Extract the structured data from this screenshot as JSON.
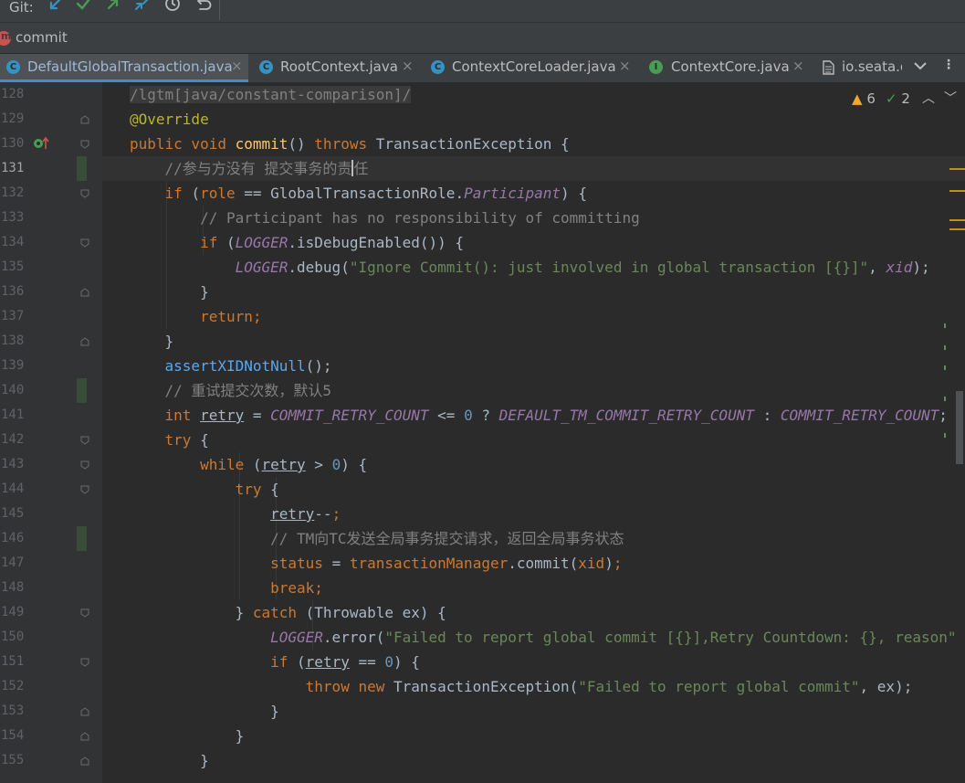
{
  "git_toolbar": {
    "label": "Git:",
    "icons": [
      "update-project-icon",
      "commit-check-icon",
      "push-arrow-icon",
      "merge-icon",
      "history-clock-icon",
      "rollback-icon"
    ],
    "colors": {
      "blue": "#3592c4",
      "green": "#499c54",
      "gray": "#bbbbbb"
    }
  },
  "breadcrumb": {
    "method_icon": "method-m-icon",
    "method_letter": "m",
    "label": "commit"
  },
  "tabs": [
    {
      "label": "DefaultGlobalTransaction.java",
      "icon": "class-c-icon",
      "icon_letter": "C",
      "active": true,
      "close": "×"
    },
    {
      "label": "RootContext.java",
      "icon": "class-c-icon",
      "icon_letter": "C",
      "active": false,
      "close": "×"
    },
    {
      "label": "ContextCoreLoader.java",
      "icon": "class-c-icon",
      "icon_letter": "C",
      "active": false,
      "close": "×"
    },
    {
      "label": "ContextCore.java",
      "icon": "interface-i-icon",
      "icon_letter": "I",
      "active": false,
      "close": "×"
    },
    {
      "label": "io.seata.c",
      "icon": "file-icon",
      "icon_letter": "",
      "active": false,
      "close": ""
    }
  ],
  "tab_more": "⋮",
  "inspection": {
    "warnings": "6",
    "weak_warnings": "2"
  },
  "editor": {
    "current_line": "131",
    "lines": [
      {
        "n": "128",
        "tokens": [
          [
            "cm",
            "/lgtm[java/constant-comparison]/"
          ]
        ]
      },
      {
        "n": "129",
        "tokens": [
          [
            "an",
            "@Override"
          ]
        ]
      },
      {
        "n": "130",
        "tokens": [
          [
            "kw",
            "public void "
          ],
          [
            "fn",
            "commit"
          ],
          [
            "",
            "() "
          ],
          [
            "kw",
            "throws "
          ],
          [
            "",
            "TransactionException {"
          ]
        ]
      },
      {
        "n": "131",
        "tokens": [
          [
            "",
            "    "
          ],
          [
            "cm",
            "//参与方没有 提交事务的责"
          ],
          [
            "caret",
            ""
          ],
          [
            "cm",
            "任"
          ]
        ]
      },
      {
        "n": "132",
        "tokens": [
          [
            "",
            "    "
          ],
          [
            "kw",
            "if "
          ],
          [
            "",
            "("
          ],
          [
            "kw",
            "role "
          ],
          [
            "",
            "== GlobalTransactionRole."
          ],
          [
            "cs",
            "Participant"
          ],
          [
            "",
            ") {"
          ]
        ]
      },
      {
        "n": "133",
        "tokens": [
          [
            "",
            "        "
          ],
          [
            "cm",
            "// Participant has no responsibility of committing"
          ]
        ]
      },
      {
        "n": "134",
        "tokens": [
          [
            "",
            "        "
          ],
          [
            "kw",
            "if "
          ],
          [
            "",
            "("
          ],
          [
            "cs",
            "LOGGER"
          ],
          [
            "",
            ".isDebugEnabled()) {"
          ]
        ]
      },
      {
        "n": "135",
        "tokens": [
          [
            "",
            "            "
          ],
          [
            "cs",
            "LOGGER"
          ],
          [
            "",
            ".debug("
          ],
          [
            "st",
            "\"Ignore Commit(): just involved in global transaction [{}]\""
          ],
          [
            "",
            ", "
          ],
          [
            "cs",
            "xid"
          ],
          [
            "",
            ");"
          ]
        ]
      },
      {
        "n": "136",
        "tokens": [
          [
            "",
            "        }"
          ]
        ]
      },
      {
        "n": "137",
        "tokens": [
          [
            "",
            "        "
          ],
          [
            "kw",
            "return;"
          ]
        ]
      },
      {
        "n": "138",
        "tokens": [
          [
            "",
            "    }"
          ]
        ]
      },
      {
        "n": "139",
        "tokens": [
          [
            "",
            "    "
          ],
          [
            "mt",
            "assertXIDNotNull"
          ],
          [
            "",
            "();"
          ]
        ]
      },
      {
        "n": "140",
        "tokens": [
          [
            "",
            "    "
          ],
          [
            "cm",
            "// 重试提交次数，默认5"
          ]
        ]
      },
      {
        "n": "141",
        "tokens": [
          [
            "",
            "    "
          ],
          [
            "kw",
            "int "
          ],
          [
            "lv",
            "retry"
          ],
          [
            "",
            " = "
          ],
          [
            "cs",
            "COMMIT_RETRY_COUNT"
          ],
          [
            "",
            " <= "
          ],
          [
            "nm",
            "0"
          ],
          [
            "",
            " ? "
          ],
          [
            "cs",
            "DEFAULT_TM_COMMIT_RETRY_COUNT"
          ],
          [
            "",
            " : "
          ],
          [
            "cs",
            "COMMIT_RETRY_COUNT"
          ],
          [
            "",
            ";"
          ]
        ]
      },
      {
        "n": "142",
        "tokens": [
          [
            "",
            "    "
          ],
          [
            "kw",
            "try "
          ],
          [
            "",
            "{"
          ]
        ]
      },
      {
        "n": "143",
        "tokens": [
          [
            "",
            "        "
          ],
          [
            "kw",
            "while "
          ],
          [
            "",
            "("
          ],
          [
            "lv",
            "retry"
          ],
          [
            "",
            " > "
          ],
          [
            "nm",
            "0"
          ],
          [
            "",
            ") {"
          ]
        ]
      },
      {
        "n": "144",
        "tokens": [
          [
            "",
            "            "
          ],
          [
            "kw",
            "try "
          ],
          [
            "",
            "{"
          ]
        ]
      },
      {
        "n": "145",
        "tokens": [
          [
            "",
            "                "
          ],
          [
            "lv",
            "retry"
          ],
          [
            "",
            "--"
          ],
          [
            "kw",
            ";"
          ]
        ]
      },
      {
        "n": "146",
        "tokens": [
          [
            "",
            "                "
          ],
          [
            "cm",
            "// TM向TC发送全局事务提交请求，返回全局事务状态"
          ]
        ]
      },
      {
        "n": "147",
        "tokens": [
          [
            "",
            "                "
          ],
          [
            "kw",
            "status "
          ],
          [
            "",
            "= "
          ],
          [
            "kw",
            "transactionManager"
          ],
          [
            "",
            ".commit("
          ],
          [
            "kw",
            "xid"
          ],
          [
            "",
            ")"
          ],
          [
            "kw",
            ";"
          ]
        ]
      },
      {
        "n": "148",
        "tokens": [
          [
            "",
            "                "
          ],
          [
            "kw",
            "break;"
          ]
        ]
      },
      {
        "n": "149",
        "tokens": [
          [
            "",
            "            } "
          ],
          [
            "kw",
            "catch "
          ],
          [
            "",
            "(Throwable ex) {"
          ]
        ]
      },
      {
        "n": "150",
        "tokens": [
          [
            "",
            "                "
          ],
          [
            "cs",
            "LOGGER"
          ],
          [
            "",
            ".error("
          ],
          [
            "st",
            "\"Failed to report global commit [{}],Retry Countdown: {}, reason\""
          ]
        ]
      },
      {
        "n": "151",
        "tokens": [
          [
            "",
            "                "
          ],
          [
            "kw",
            "if "
          ],
          [
            "",
            "("
          ],
          [
            "lv",
            "retry"
          ],
          [
            "",
            " == "
          ],
          [
            "nm",
            "0"
          ],
          [
            "",
            ") {"
          ]
        ]
      },
      {
        "n": "152",
        "tokens": [
          [
            "",
            "                    "
          ],
          [
            "kw",
            "throw new "
          ],
          [
            "",
            "TransactionException("
          ],
          [
            "st",
            "\"Failed to report global commit\""
          ],
          [
            "",
            ", ex);"
          ]
        ]
      },
      {
        "n": "153",
        "tokens": [
          [
            "",
            "                }"
          ]
        ]
      },
      {
        "n": "154",
        "tokens": [
          [
            "",
            "            }"
          ]
        ]
      },
      {
        "n": "155",
        "tokens": [
          [
            "",
            "        }"
          ]
        ]
      }
    ]
  }
}
